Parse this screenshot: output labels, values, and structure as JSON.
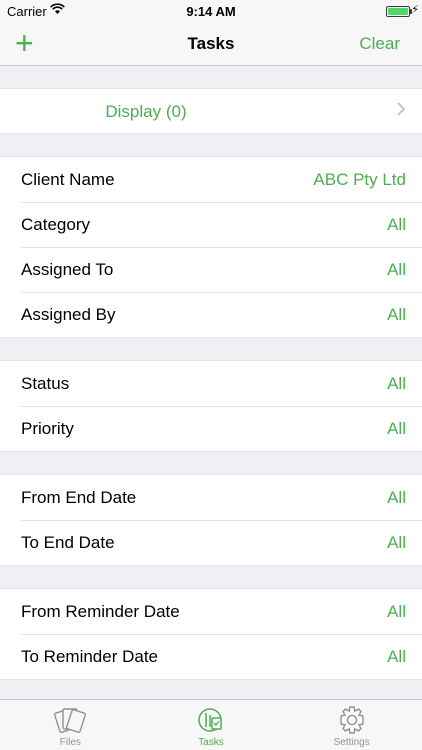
{
  "status_bar": {
    "carrier": "Carrier",
    "time": "9:14 AM"
  },
  "nav": {
    "add_label": "+",
    "title": "Tasks",
    "clear_label": "Clear"
  },
  "display": {
    "label": "Display (0)"
  },
  "groups": [
    [
      {
        "label": "Client Name",
        "value": "ABC Pty Ltd"
      },
      {
        "label": "Category",
        "value": "All"
      },
      {
        "label": "Assigned To",
        "value": "All"
      },
      {
        "label": "Assigned By",
        "value": "All"
      }
    ],
    [
      {
        "label": "Status",
        "value": "All"
      },
      {
        "label": "Priority",
        "value": "All"
      }
    ],
    [
      {
        "label": "From End Date",
        "value": "All"
      },
      {
        "label": "To End Date",
        "value": "All"
      }
    ],
    [
      {
        "label": "From Reminder Date",
        "value": "All"
      },
      {
        "label": "To Reminder Date",
        "value": "All"
      }
    ]
  ],
  "tabs": [
    {
      "label": "Files",
      "icon": "files-icon",
      "active": false
    },
    {
      "label": "Tasks",
      "icon": "tasks-icon",
      "active": true
    },
    {
      "label": "Settings",
      "icon": "gear-icon",
      "active": false
    }
  ],
  "colors": {
    "accent": "#4caf50",
    "background": "#efeff4"
  }
}
